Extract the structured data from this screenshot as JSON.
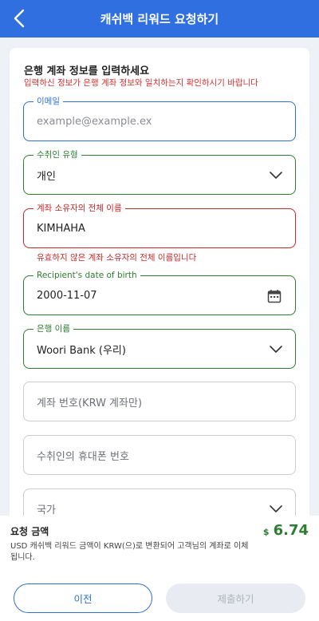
{
  "header": {
    "title": "캐쉬백 리워드 요청하기"
  },
  "form": {
    "section_title": "은행 계좌 정보를 입력하세요",
    "section_subtitle": "입력하신 정보가 은행 계좌 정보와 일치하는지 확인하시기 바랍니다",
    "email": {
      "label": "이메일",
      "placeholder": "example@example.ex",
      "value": ""
    },
    "recipient_type": {
      "label": "수취인 유형",
      "value": "개인"
    },
    "account_holder": {
      "label": "계좌 소유자의 전체 이름",
      "value": "KIMHAHA",
      "error": "유효하지 않은 계좌 소유자의 전체 이름입니다"
    },
    "dob": {
      "label": "Recipient's date of birth",
      "value": "2000-11-07"
    },
    "bank": {
      "label": "은행 이름",
      "value": "Woori Bank (우리)"
    },
    "account_number": {
      "placeholder": "계좌 번호(KRW 계좌만)"
    },
    "phone": {
      "placeholder": "수취인의 휴대폰 번호"
    },
    "country": {
      "placeholder": "국가"
    }
  },
  "summary": {
    "amount_label": "요청 금액",
    "currency_symbol": "$",
    "amount": "6.74",
    "description": "USD 캐쉬백 리워드 금액이 KRW(으)로 변환되어 고객님의 계좌로 이체됩니다."
  },
  "buttons": {
    "prev": "이전",
    "submit": "제출하기"
  },
  "colors": {
    "header": "#2f6fe0",
    "focus": "#2d6fd6",
    "valid": "#2e7d32",
    "error": "#c62828"
  }
}
